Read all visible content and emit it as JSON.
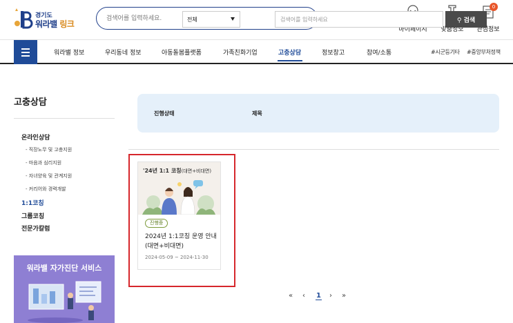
{
  "header": {
    "logo_top": "경기도",
    "logo_main_a": "워라밸",
    "logo_main_b": "링크",
    "search_placeholder": "검색어를 입력하세요.",
    "utils": [
      {
        "label": "마이페이지",
        "icon": "user-icon"
      },
      {
        "label": "맞춤정보",
        "icon": "stamp-icon"
      },
      {
        "label": "관심정보",
        "icon": "document-icon",
        "badge": "0"
      }
    ]
  },
  "nav": {
    "items": [
      "워라밸 정보",
      "우리동네 정보",
      "아동돌봄플랫폼",
      "가족친화기업",
      "고충상담",
      "정보창고",
      "참여/소통"
    ],
    "active_index": 4,
    "tags": [
      "#시군등기타",
      "#중앙부처정책"
    ]
  },
  "sidebar": {
    "title": "고충상담",
    "category": "온라인상담",
    "subitems": [
      "직장노무 및 고충지원",
      "마음과 심리지원",
      "자녀양육 및 관계지원",
      "커리어와 경력개발"
    ],
    "links": [
      "1:1코칭",
      "그룹코칭",
      "전문가칼럼"
    ],
    "active_link": 0,
    "banner_title": "워라밸 자가진단 서비스"
  },
  "filter": {
    "status_label": "진행상태",
    "status_value": "전체",
    "title_label": "제목",
    "input_placeholder": "검색어를 입력하세요",
    "search_button": "검색"
  },
  "cards": [
    {
      "image_title_main": "'24년 1:1 코칭",
      "image_title_sub": "(대면+비대면)",
      "status": "진행중",
      "title": "2024년 1:1코칭 운영 안내(대면+비대면)",
      "date": "2024-05-09 ~ 2024-11-30"
    }
  ],
  "pagination": {
    "first": "«",
    "prev": "‹",
    "current": "1",
    "next": "›",
    "last": "»"
  },
  "colors": {
    "brand": "#1f4b98",
    "highlight": "#d6262b",
    "filter_bg": "#e5f0fa",
    "banner": "#8e7fd3"
  }
}
